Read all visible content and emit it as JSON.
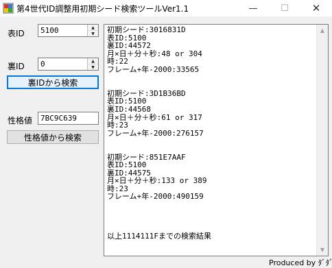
{
  "window": {
    "title": "第4世代ID調整用初期シード検索ツールVer1.1",
    "minimize": "—",
    "maximize": "☐",
    "close": "✕"
  },
  "form": {
    "tid_label": "表ID",
    "tid_value": "5100",
    "sid_label": "裏ID",
    "sid_value": "0",
    "search_sid_button": "裏IDから検索",
    "pid_label": "性格値",
    "pid_value": "7BC9C639",
    "search_pid_button": "性格値から検索"
  },
  "output": {
    "lines": [
      "初期シード:3016831D",
      "表ID:5100",
      "裏ID:44572",
      "月×日＋分＋秒:48 or 304",
      "時:22",
      "フレーム+年-2000:33565",
      "",
      "",
      "初期シード:3D1B36BD",
      "表ID:5100",
      "裏ID:44568",
      "月×日＋分＋秒:61 or 317",
      "時:23",
      "フレーム+年-2000:276157",
      "",
      "",
      "初期シード:851E7AAF",
      "表ID:5100",
      "裏ID:44575",
      "月×日＋分＋秒:133 or 389",
      "時:23",
      "フレーム+年-2000:490159",
      "",
      "",
      "",
      "",
      "以上1114111Fまでの検索結果"
    ]
  },
  "footer": {
    "credit": "Produced by ﾀﾞﾀﾞ"
  },
  "colors": {
    "focus_border": "#0078d7",
    "window_bg": "#f0f0f0"
  },
  "icons": {
    "app": "app-grid-icon",
    "spin_up": "triangle-up",
    "spin_down": "triangle-down"
  }
}
